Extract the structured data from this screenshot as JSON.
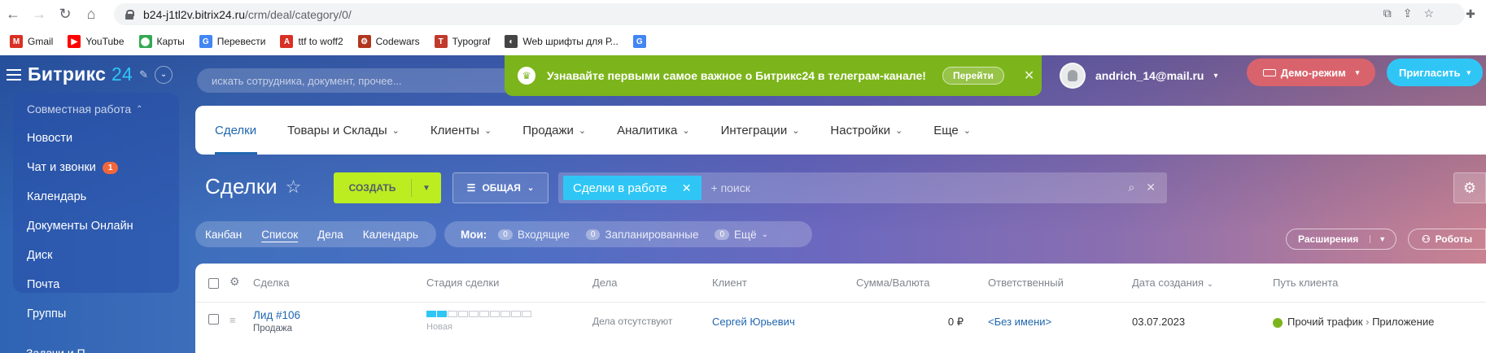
{
  "browser": {
    "url_host": "b24-j1tl2v.bitrix24.ru",
    "url_path": "/crm/deal/category/0/",
    "bookmarks": [
      {
        "label": "Gmail",
        "icon": "gmail-icon",
        "color": "#d93025",
        "glyph": "M"
      },
      {
        "label": "YouTube",
        "icon": "youtube-icon",
        "color": "#ff0000",
        "glyph": "▶"
      },
      {
        "label": "Карты",
        "icon": "maps-icon",
        "color": "#34a853",
        "glyph": "⬤"
      },
      {
        "label": "Перевести",
        "icon": "translate-icon",
        "color": "#4285f4",
        "glyph": "G"
      },
      {
        "label": "ttf to woff2",
        "icon": "font-tool-icon",
        "color": "#d93025",
        "glyph": "A"
      },
      {
        "label": "Codewars",
        "icon": "codewars-icon",
        "color": "#b1361e",
        "glyph": "⚙"
      },
      {
        "label": "Typograf",
        "icon": "typograf-icon",
        "color": "#c0392b",
        "glyph": "T"
      },
      {
        "label": "Web шрифты для Р...",
        "icon": "globe-icon",
        "color": "#444444",
        "glyph": "◐"
      },
      {
        "label": "",
        "icon": "google-icon",
        "color": "#4285f4",
        "glyph": "G"
      }
    ]
  },
  "header": {
    "logo_main": "Битрикс",
    "logo_num": "24",
    "search_placeholder": "искать сотрудника, документ, прочее...",
    "banner_text": "Узнавайте первыми самое важное о Битрикс24 в телеграм-канале!",
    "banner_button": "Перейти",
    "user_email": "andrich_14@mail.ru",
    "demo_label": "Демо-режим",
    "invite_label": "Пригласить"
  },
  "sidebar": {
    "group": "Совместная работа",
    "items": [
      {
        "label": "Новости"
      },
      {
        "label": "Чат и звонки",
        "counter": "1"
      },
      {
        "label": "Календарь"
      },
      {
        "label": "Документы Онлайн"
      },
      {
        "label": "Диск"
      },
      {
        "label": "Почта"
      },
      {
        "label": "Группы"
      }
    ],
    "peek": "Задачи и П..."
  },
  "topnav": {
    "tabs": [
      {
        "label": "Сделки",
        "active": true
      },
      {
        "label": "Товары и Склады"
      },
      {
        "label": "Клиенты"
      },
      {
        "label": "Продажи"
      },
      {
        "label": "Аналитика"
      },
      {
        "label": "Интеграции"
      },
      {
        "label": "Настройки"
      },
      {
        "label": "Еще"
      }
    ]
  },
  "toolbar": {
    "title": "Сделки",
    "create_label": "СОЗДАТЬ",
    "filter_label": "ОБЩАЯ",
    "filter_chip": "Сделки в работе",
    "filter_placeholder": "+ поиск"
  },
  "views": {
    "items": [
      "Канбан",
      "Список",
      "Дела",
      "Календарь"
    ],
    "current": "Список"
  },
  "counters": {
    "label": "Мои:",
    "items": [
      {
        "num": "0",
        "label": "Входящие"
      },
      {
        "num": "0",
        "label": "Запланированные"
      },
      {
        "num": "0",
        "label": "Ещё"
      }
    ]
  },
  "right_actions": {
    "extensions": "Расширения",
    "robots": "Роботы"
  },
  "grid": {
    "columns": [
      "Сделка",
      "Стадия сделки",
      "Дела",
      "Клиент",
      "Сумма/Валюта",
      "Ответственный",
      "Дата создания",
      "Путь клиента"
    ],
    "rows": [
      {
        "deal": "Лид #106",
        "deal_sub": "Продажа",
        "stage": "Новая",
        "stage_filled": 2,
        "stage_total": 10,
        "tasks": "Дела отсутствуют",
        "client": "Сергей Юрьевич",
        "sum": "0 ₽",
        "responsible": "<Без имени>",
        "created": "03.07.2023",
        "path_from": "Прочий трафик",
        "path_to": "Приложение"
      }
    ]
  },
  "colors": {
    "accent": "#2067b0",
    "create": "#bbed21",
    "chip": "#2fc6f6",
    "banner": "#7cb51b",
    "demo": "#d9636c",
    "invite": "#2fc6f6"
  }
}
